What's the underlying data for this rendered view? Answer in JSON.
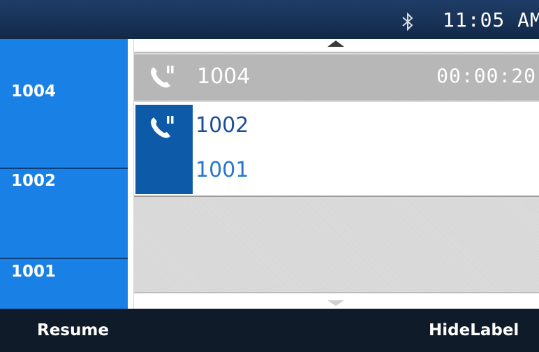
{
  "status_bar": {
    "bluetooth_icon": "bluetooth-icon",
    "time": "11:05 AM"
  },
  "line_keys": [
    {
      "label": "1004"
    },
    {
      "label": "1002"
    },
    {
      "label": "1001"
    }
  ],
  "calls": {
    "held": {
      "icon": "phone-call-icon",
      "number": "1004",
      "duration": "00:00:20"
    },
    "active": {
      "icon": "phone-call-icon",
      "numbers": [
        "1002",
        "1001"
      ]
    }
  },
  "softkeys": {
    "left_label": "Resume",
    "right_label": "HideLabel"
  },
  "colors": {
    "line_key_bg": "#1980e6",
    "active_call_icon_bg": "#0d5aa8",
    "held_call_bg": "#b7b7b7",
    "status_bar_bg": "#1a3560",
    "softkey_bar_bg": "#101b2a"
  }
}
